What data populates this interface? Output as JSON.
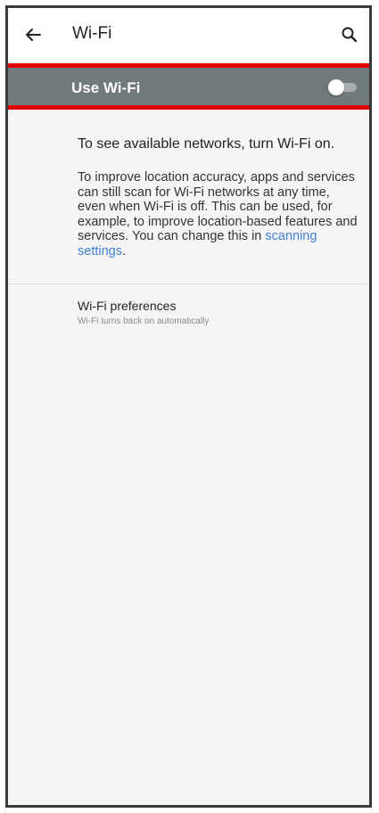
{
  "app_bar": {
    "title": "Wi-Fi",
    "back_icon": "arrow-left-icon",
    "search_icon": "search-icon"
  },
  "master_switch": {
    "label": "Use Wi-Fi",
    "state": "off",
    "highlight_color": "#e10000"
  },
  "off_message": "To see available networks, turn Wi-Fi on.",
  "scan_note": {
    "text": "To improve location accuracy, apps and services can still scan for Wi-Fi networks at any time, even when Wi-Fi is off. This can be used, for example, to improve location-based features and services. You can change this in ",
    "link": "scanning settings",
    "suffix": "."
  },
  "preferences": {
    "title": "Wi-Fi preferences",
    "subtitle": "Wi-Fi turns back on automatically"
  }
}
